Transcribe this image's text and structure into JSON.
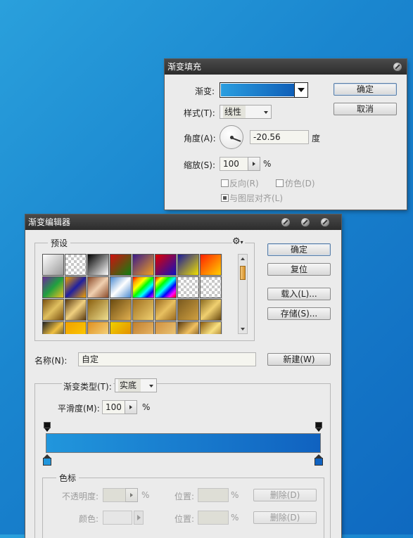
{
  "gradient_fill": {
    "title": "渐变填充",
    "gradient_label": "渐变:",
    "style_label": "样式(T):",
    "style_value": "线性",
    "angle_label": "角度(A):",
    "angle_value": "-20.56",
    "angle_unit": "度",
    "scale_label": "缩放(S):",
    "scale_value": "100",
    "scale_unit": "%",
    "reverse_label": "反向(R)",
    "dither_label": "仿色(D)",
    "align_label": "与图层对齐(L)",
    "reverse_checked": false,
    "dither_checked": false,
    "align_checked": true,
    "ok_label": "确定",
    "cancel_label": "取消",
    "gradient_colors": [
      "#2a9ee0",
      "#0f5fb8"
    ]
  },
  "gradient_editor": {
    "title": "渐变编辑器",
    "presets_label": "预设",
    "ok_label": "确定",
    "reset_label": "复位",
    "load_label": "载入(L)...",
    "save_label": "存储(S)...",
    "name_label": "名称(N):",
    "name_value": "自定",
    "new_label": "新建(W)",
    "type_label": "渐变类型(T):",
    "type_value": "实底",
    "smooth_label": "平滑度(M):",
    "smooth_value": "100",
    "smooth_unit": "%",
    "stops_group_label": "色标",
    "opacity_label": "不透明度:",
    "opacity_unit": "%",
    "location_label": "位置:",
    "location_unit": "%",
    "delete_label": "删除(D)",
    "color_label": "颜色:",
    "gradient_colors": [
      "#2196dc",
      "#1062c0"
    ]
  }
}
